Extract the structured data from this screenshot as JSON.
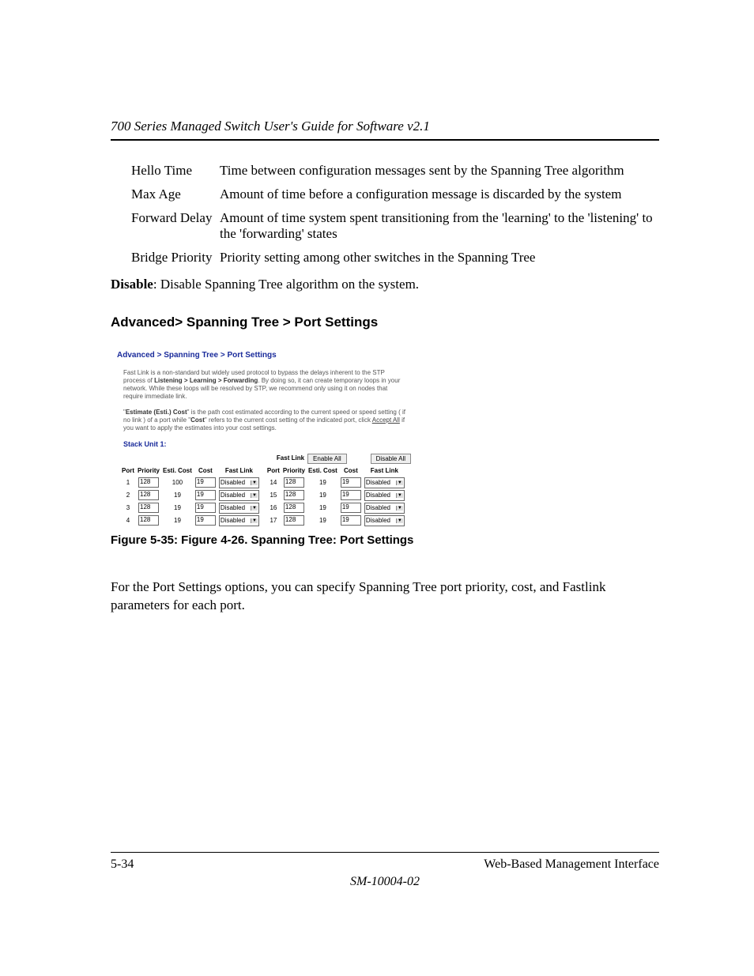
{
  "header": {
    "running_title": "700 Series Managed Switch User's Guide for Software v2.1"
  },
  "definitions": [
    {
      "term": "Hello Time",
      "desc": "Time between configuration messages sent by the Spanning Tree algorithm"
    },
    {
      "term": "Max Age",
      "desc": "Amount of time before a configuration message is discarded by the system"
    },
    {
      "term": "Forward Delay",
      "desc": "Amount of time system spent transitioning from the 'learning' to the 'listening' to the 'forwarding' states"
    },
    {
      "term": "Bridge Priority",
      "desc": "Priority setting among other switches in the Spanning Tree"
    }
  ],
  "disable": {
    "label": "Disable",
    "text": ":  Disable Spanning Tree algorithm on the system."
  },
  "section_heading": "Advanced> Spanning Tree > Port Settings",
  "screenshot": {
    "title": "Advanced > Spanning Tree > Port Settings",
    "para1_a": "Fast Link is a non-standard but widely used protocol to bypass the delays inherent to the STP process of ",
    "para1_b": "Listening > Learning > Forwarding",
    "para1_c": ". By doing so, it can create temporary loops in your network. While these loops will be resolved by STP, we recommend only using it on nodes that require immediate link.",
    "para2_a": "\"",
    "para2_b": "Estimate (Esti.) Cost",
    "para2_c": "\" is the path cost estimated according to the current speed or speed setting ( if no link ) of a port while \"",
    "para2_d": "Cost",
    "para2_e": "\" refers to the current cost setting of the indicated port, click ",
    "para2_f": "Accept All",
    "para2_g": " if you want to apply the estimates into your cost settings.",
    "stack_label": "Stack Unit 1:",
    "toolbar": {
      "fastlink_label": "Fast Link",
      "enable_all": "Enable All",
      "disable_all": "Disable All"
    },
    "columns": {
      "port": "Port",
      "priority": "Priority",
      "esti_cost": "Esti. Cost",
      "cost": "Cost",
      "fastlink": "Fast Link"
    },
    "left_rows": [
      {
        "port": "1",
        "priority": "128",
        "esti": "100",
        "cost": "19",
        "fastlink": "Disabled"
      },
      {
        "port": "2",
        "priority": "128",
        "esti": "19",
        "cost": "19",
        "fastlink": "Disabled"
      },
      {
        "port": "3",
        "priority": "128",
        "esti": "19",
        "cost": "19",
        "fastlink": "Disabled"
      },
      {
        "port": "4",
        "priority": "128",
        "esti": "19",
        "cost": "19",
        "fastlink": "Disabled"
      }
    ],
    "right_rows": [
      {
        "port": "14",
        "priority": "128",
        "esti": "19",
        "cost": "19",
        "fastlink": "Disabled"
      },
      {
        "port": "15",
        "priority": "128",
        "esti": "19",
        "cost": "19",
        "fastlink": "Disabled"
      },
      {
        "port": "16",
        "priority": "128",
        "esti": "19",
        "cost": "19",
        "fastlink": "Disabled"
      },
      {
        "port": "17",
        "priority": "128",
        "esti": "19",
        "cost": "19",
        "fastlink": "Disabled"
      }
    ]
  },
  "figure_caption": "Figure 5-35:  Figure 4-26. Spanning Tree: Port Settings",
  "body_paragraph": "For the Port Settings options, you can specify Spanning Tree port priority, cost, and Fastlink parameters for each port.",
  "footer": {
    "page_num": "5-34",
    "section": "Web-Based Management Interface",
    "doc_id": "SM-10004-02"
  }
}
